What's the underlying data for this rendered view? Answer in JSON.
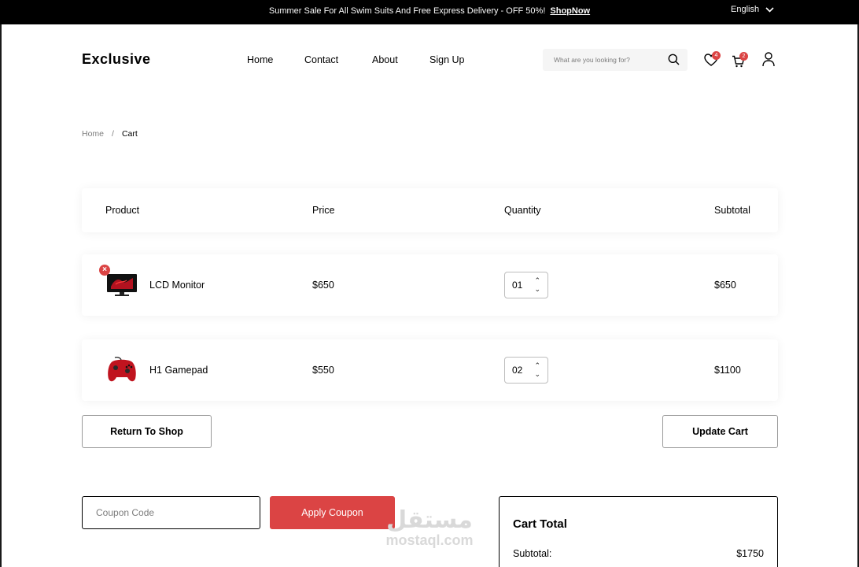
{
  "banner": {
    "promo_text": "Summer Sale For All Swim Suits And Free Express Delivery - OFF 50%!",
    "promo_link": "ShopNow",
    "language": "English"
  },
  "header": {
    "logo": "Exclusive",
    "nav": [
      "Home",
      "Contact",
      "About",
      "Sign Up"
    ],
    "search_placeholder": "What are you looking for?",
    "wishlist_count": "4",
    "cart_count": "2"
  },
  "breadcrumb": {
    "home": "Home",
    "separator": "/",
    "current": "Cart"
  },
  "table": {
    "headers": {
      "product": "Product",
      "price": "Price",
      "quantity": "Quantity",
      "subtotal": "Subtotal"
    },
    "items": [
      {
        "name": "LCD Monitor",
        "price": "$650",
        "quantity": "01",
        "subtotal": "$650",
        "icon": "monitor-icon"
      },
      {
        "name": "H1 Gamepad",
        "price": "$550",
        "quantity": "02",
        "subtotal": "$1100",
        "icon": "gamepad-icon"
      }
    ]
  },
  "actions": {
    "return_label": "Return To Shop",
    "update_label": "Update Cart",
    "coupon_placeholder": "Coupon Code",
    "apply_label": "Apply Coupon"
  },
  "cart_total": {
    "title": "Cart Total",
    "subtotal_label": "Subtotal:",
    "subtotal_value": "$1750"
  },
  "watermark": {
    "arabic": "مستقل",
    "latin": "mostaql.com"
  },
  "colors": {
    "accent": "#db4444",
    "banner_bg": "#000000"
  }
}
